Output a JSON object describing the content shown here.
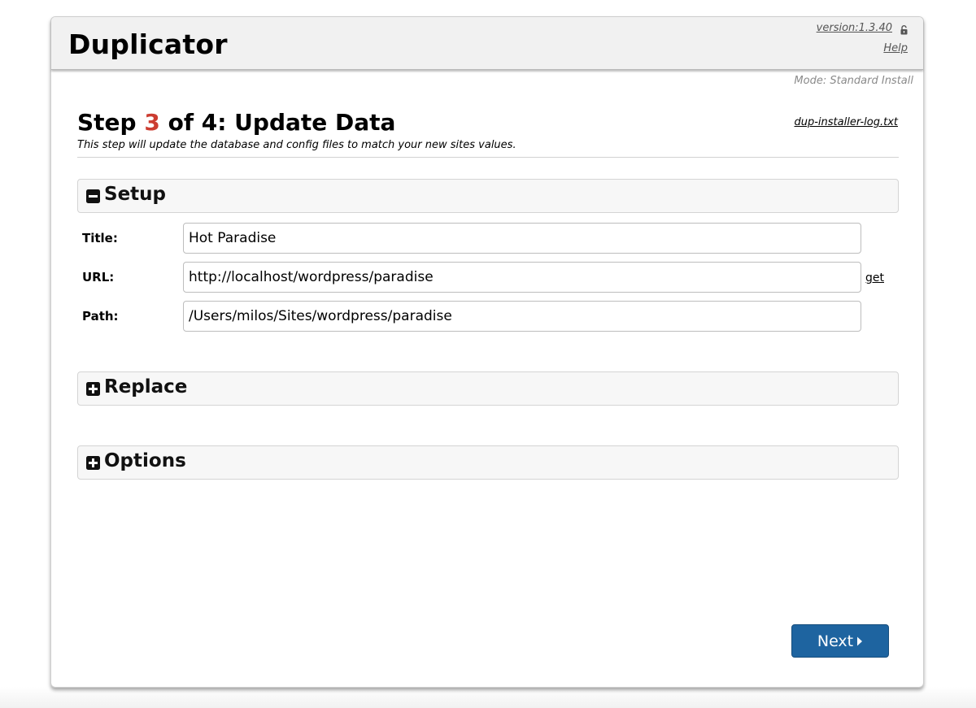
{
  "header": {
    "app_title": "Duplicator",
    "version": "version:1.3.40",
    "help_label": "Help",
    "lock_icon": "lock-icon"
  },
  "mode_text": "Mode: Standard Install",
  "step": {
    "prefix": "Step ",
    "number": "3",
    "suffix": " of 4: Update Data",
    "description": "This step will update the database and config files to match your new sites values.",
    "log_link": "dup-installer-log.txt"
  },
  "sections": {
    "setup": {
      "label": "Setup",
      "state": "expanded",
      "icon": "minus-square-icon"
    },
    "replace": {
      "label": "Replace",
      "state": "collapsed",
      "icon": "plus-square-icon"
    },
    "options": {
      "label": "Options",
      "state": "collapsed",
      "icon": "plus-square-icon"
    }
  },
  "setup_fields": {
    "title": {
      "label": "Title:",
      "value": "Hot Paradise"
    },
    "url": {
      "label": "URL:",
      "value": "http://localhost/wordpress/paradise",
      "get_label": "get"
    },
    "path": {
      "label": "Path:",
      "value": "/Users/milos/Sites/wordpress/paradise"
    }
  },
  "next_button": {
    "label": "Next",
    "icon": "caret-right-icon"
  },
  "colors": {
    "accent_step_number": "#cc3d31",
    "primary_button": "#1e64a0"
  }
}
